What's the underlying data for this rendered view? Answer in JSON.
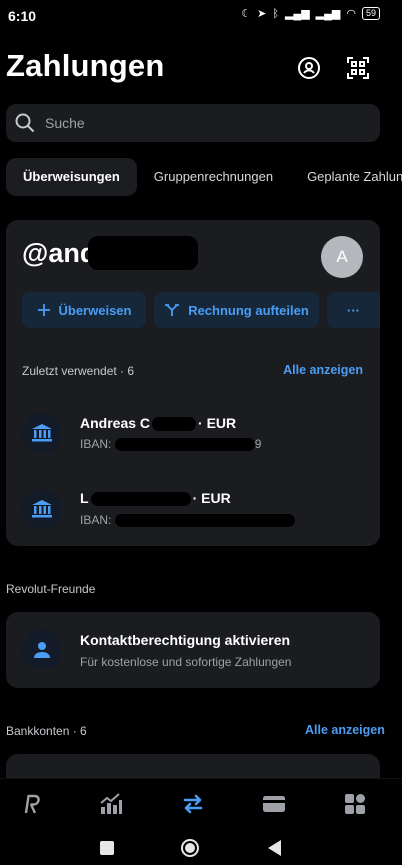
{
  "status_bar": {
    "time": "6:10",
    "battery": "59"
  },
  "header": {
    "title": "Zahlungen"
  },
  "search": {
    "placeholder": "Suche"
  },
  "tabs": [
    {
      "label": "Überweisungen",
      "active": true
    },
    {
      "label": "Gruppenrechnungen",
      "active": false
    },
    {
      "label": "Geplante Zahlung",
      "active": false
    }
  ],
  "profile_card": {
    "handle": "@and",
    "avatar_letter": "A",
    "actions": {
      "transfer": "Überweisen",
      "split": "Rechnung aufteilen",
      "more": "···"
    },
    "recent_label": "Zuletzt verwendet · 6",
    "see_all": "Alle anzeigen",
    "recent": [
      {
        "title": "Andreas C",
        "currency": "· EUR",
        "sub": "IBAN: ",
        "sub_tail": "9"
      },
      {
        "title": "L",
        "currency": "· EUR",
        "sub": "IBAN: ",
        "sub_tail": ""
      }
    ]
  },
  "friends": {
    "section": "Revolut-Freunde",
    "title": "Kontaktberechtigung aktivieren",
    "subtitle": "Für kostenlose und sofortige Zahlungen"
  },
  "bank_accounts": {
    "section": "Bankkonten · 6",
    "see_all": "Alle anzeigen"
  },
  "bottom_nav": [
    {
      "name": "home-icon"
    },
    {
      "name": "invest-icon"
    },
    {
      "name": "payments-icon",
      "active": true
    },
    {
      "name": "cards-icon"
    },
    {
      "name": "hub-icon"
    }
  ],
  "colors": {
    "accent": "#4a9df5",
    "card": "#1b1c1f",
    "background": "#000000"
  }
}
